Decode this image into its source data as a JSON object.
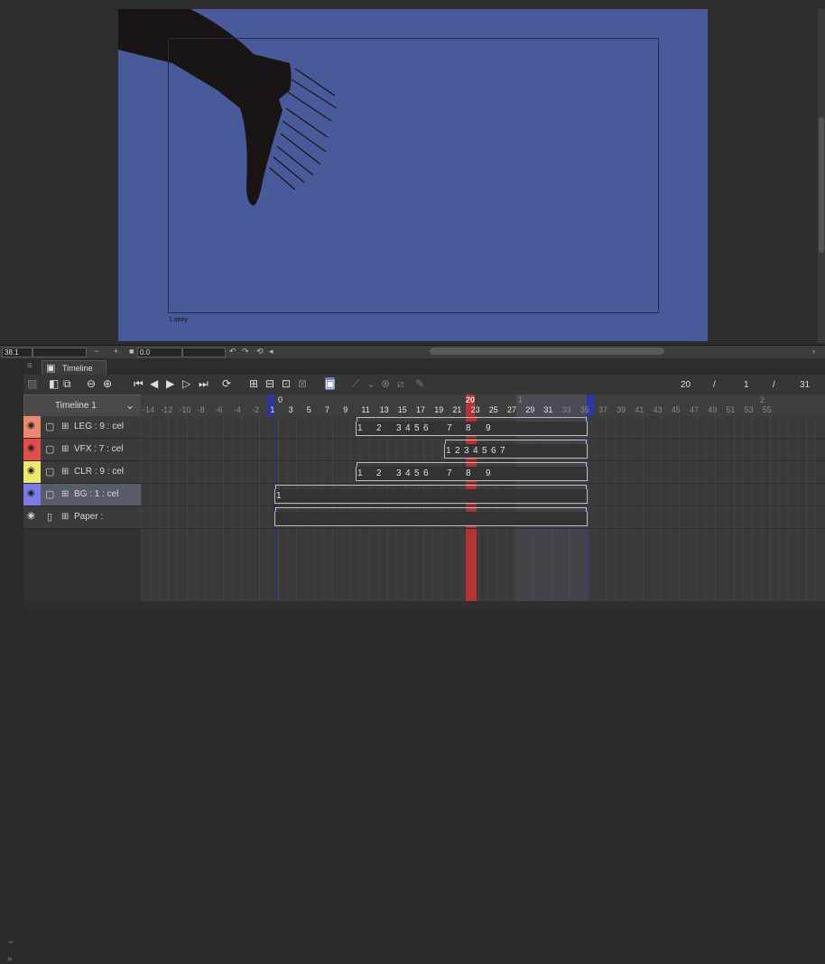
{
  "canvas": {
    "story_label": "1 story",
    "colors": {
      "paper": "#485a99",
      "silhouette": "#1a1514",
      "guide": "#1f2a55"
    }
  },
  "status_bar": {
    "zoom_value": "38.1",
    "minus_label": "−",
    "plus_label": "+",
    "angle_value": "0.0"
  },
  "timeline": {
    "tab_label": "Timeline",
    "name": "Timeline 1",
    "current_frame": "20",
    "frame_sep_1": "/",
    "sub_a": "1",
    "frame_sep_2": "/",
    "end_frame": "31",
    "ruler_ticks": [
      "-14",
      "-12",
      "-10",
      "-8",
      "-6",
      "-4",
      "-2",
      "1",
      "3",
      "5",
      "7",
      "9",
      "11",
      "13",
      "15",
      "17",
      "19",
      "21",
      "23",
      "25",
      "27",
      "29",
      "31",
      "33",
      "35",
      "37",
      "39",
      "41",
      "43",
      "45",
      "47",
      "49",
      "51",
      "53",
      "55"
    ],
    "ruler_top_marks": {
      "zero": "0",
      "current": "20",
      "second_1": "1",
      "second_2": "2"
    },
    "colors": {
      "playhead": "#b43232",
      "range_marker": "#2c37a6",
      "selection": "#4a4b55"
    }
  },
  "layers": [
    {
      "label": "LEG : 9 : cel",
      "color": "#e98a6c",
      "eye": "👁"
    },
    {
      "label": "VFX : 7 : cel",
      "color": "#e24c4c",
      "eye": "👁"
    },
    {
      "label": "CLR : 9 : cel",
      "color": "#f0ea6a",
      "eye": "👁"
    },
    {
      "label": "BG : 1 : cel",
      "color": "#7a7ae8",
      "eye": "👁"
    },
    {
      "label": "Paper :",
      "color": "#3b3b3b",
      "eye": "👁"
    }
  ],
  "tracks": {
    "leg_numbers": [
      "1",
      "2",
      "3",
      "4",
      "5",
      "6",
      "7",
      "8",
      "9"
    ],
    "vfx_numbers": [
      "1",
      "2",
      "3",
      "4",
      "5",
      "6",
      "7"
    ],
    "clr_numbers": [
      "1",
      "2",
      "3",
      "4",
      "5",
      "6",
      "7",
      "8",
      "9"
    ],
    "bg_numbers": [
      "1"
    ]
  },
  "icons": {
    "menu": "hamburger-icon",
    "timeline_tab": "timeline-icon",
    "collapse": "chevron-down-icon"
  }
}
